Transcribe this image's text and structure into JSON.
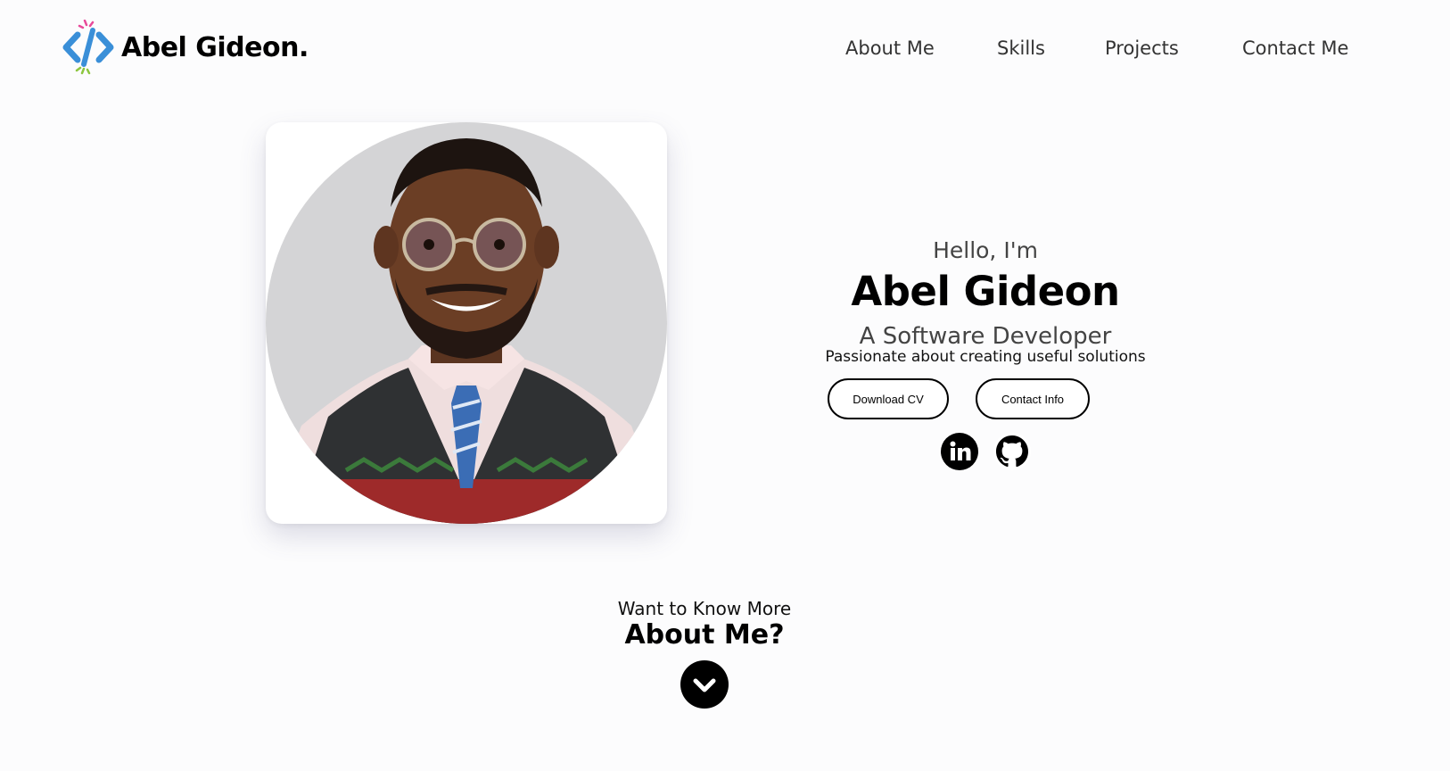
{
  "header": {
    "logo_text": "Abel Gideon.",
    "logo_icon": "code-brackets-icon",
    "nav": [
      {
        "label": "About Me"
      },
      {
        "label": "Skills"
      },
      {
        "label": "Projects"
      },
      {
        "label": "Contact Me"
      }
    ]
  },
  "profile": {
    "photo": "portrait-photo",
    "greeting": "Hello, I'm",
    "name": "Abel Gideon",
    "title": "A Software Developer",
    "tagline": "Passionate about creating useful solutions"
  },
  "actions": {
    "download_cv": "Download CV",
    "contact_info": "Contact Info"
  },
  "social": {
    "linkedin_icon": "linkedin-icon",
    "github_icon": "github-icon"
  },
  "about_prompt": {
    "subtitle": "Want to Know More",
    "title": "About Me?",
    "arrow_icon": "chevron-down-icon"
  },
  "colors": {
    "background": "#fcfcfd",
    "text": "#000000",
    "muted": "#444444",
    "logo_blue": "#3a8fd8",
    "logo_pink": "#e84a9a",
    "logo_green": "#8cc63f"
  }
}
